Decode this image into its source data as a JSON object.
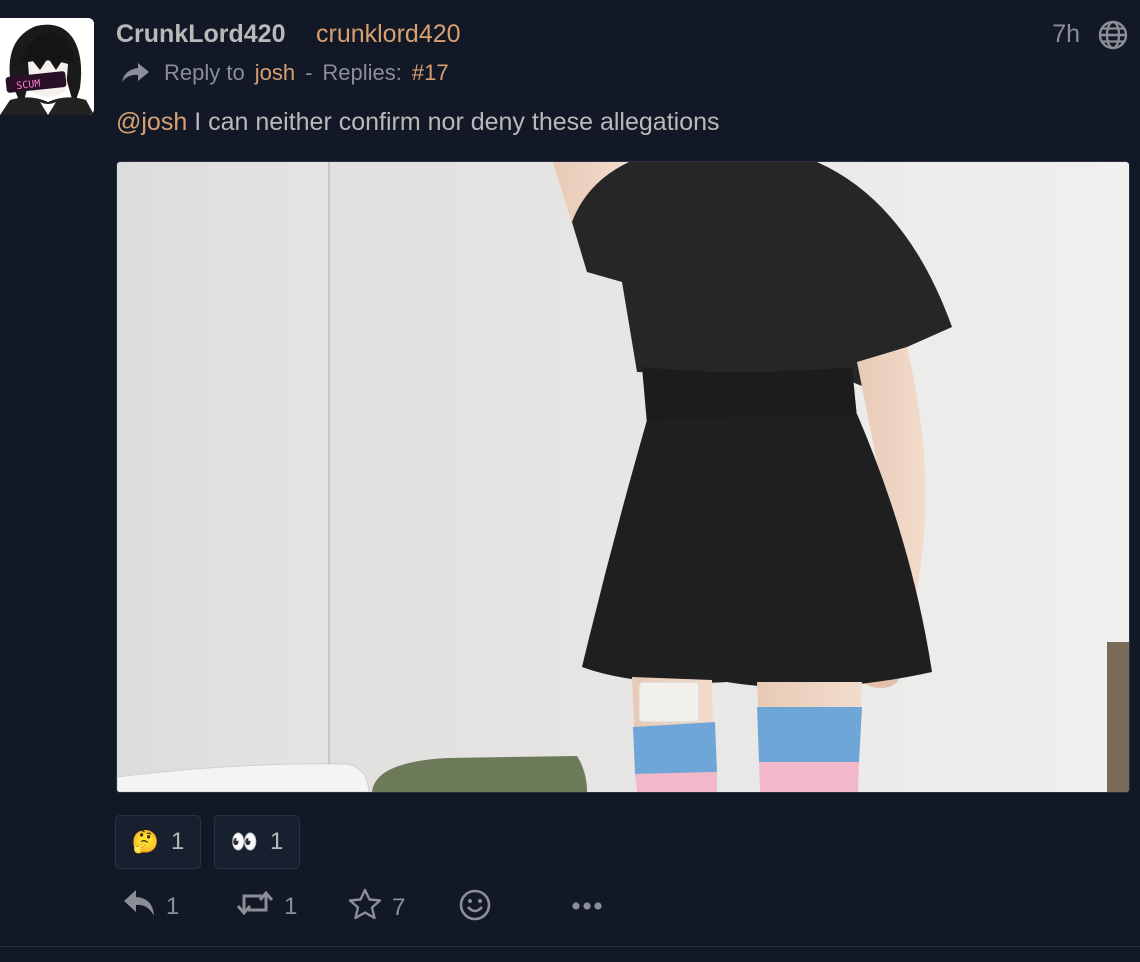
{
  "post": {
    "display_name": "CrunkLord420",
    "handle": "crunklord420",
    "time": "7h",
    "reply": {
      "prefix": "Reply to",
      "target": "josh",
      "separator": "-",
      "replies_label": "Replies:",
      "replies_value": "#17"
    },
    "content": {
      "mention": "@josh",
      "text": " I can neither confirm nor deny these allegations"
    },
    "avatar_badge": "SCUM"
  },
  "reactions": [
    {
      "emoji": "🤔",
      "count": "1"
    },
    {
      "emoji": "👀",
      "count": "1"
    }
  ],
  "actions": {
    "reply_count": "1",
    "repeat_count": "1",
    "favorite_count": "7"
  },
  "icons": [
    "reply-arrow-icon",
    "globe-icon",
    "reply-icon",
    "repeat-icon",
    "star-icon",
    "emoji-icon",
    "ellipsis-icon"
  ],
  "colors": {
    "background": "#121826",
    "accent": "#d8a070",
    "text": "#b9b9ba",
    "muted": "#8a8e96"
  }
}
